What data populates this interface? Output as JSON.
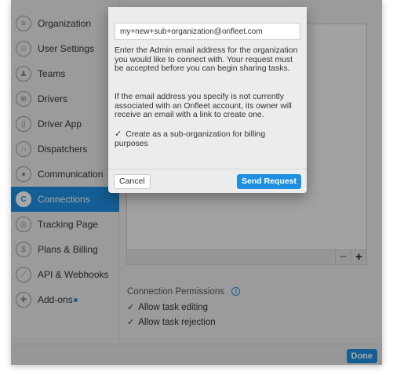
{
  "sidebar": {
    "items": [
      {
        "label": "Organization",
        "icon": "building-icon",
        "glyph": "≡",
        "active": false
      },
      {
        "label": "User Settings",
        "icon": "user-icon",
        "glyph": "☺",
        "active": false
      },
      {
        "label": "Teams",
        "icon": "team-icon",
        "glyph": "♟",
        "active": false
      },
      {
        "label": "Drivers",
        "icon": "steering-wheel-icon",
        "glyph": "⊗",
        "active": false
      },
      {
        "label": "Driver App",
        "icon": "phone-icon",
        "glyph": "▯",
        "active": false
      },
      {
        "label": "Dispatchers",
        "icon": "headset-icon",
        "glyph": "∩",
        "active": false
      },
      {
        "label": "Communication",
        "icon": "chat-bubble-icon",
        "glyph": "●",
        "active": false
      },
      {
        "label": "Connections",
        "icon": "connections-icon",
        "glyph": "C",
        "active": true
      },
      {
        "label": "Tracking Page",
        "icon": "target-icon",
        "glyph": "◎",
        "active": false
      },
      {
        "label": "Plans & Billing",
        "icon": "dollar-icon",
        "glyph": "$",
        "active": false
      },
      {
        "label": "API & Webhooks",
        "icon": "wrench-icon",
        "glyph": "⟋",
        "active": false
      },
      {
        "label": "Add-ons",
        "icon": "puzzle-icon",
        "glyph": "✚",
        "active": false,
        "has_dot": true
      }
    ]
  },
  "list_toolbar": {
    "remove_label": "−",
    "add_label": "+"
  },
  "permissions": {
    "title": "Connection Permissions",
    "options": [
      {
        "label": "Allow task editing",
        "checked": true
      },
      {
        "label": "Allow task rejection",
        "checked": true
      }
    ]
  },
  "footer": {
    "done_label": "Done"
  },
  "dialog": {
    "email_value": "my+new+sub+organization@onfleet.com",
    "paragraph1": "Enter the Admin email address for the organization you would like to connect with. Your request must be accepted before you can begin sharing tasks.",
    "paragraph2": "If the email address you specify is not currently associated with an Onfleet account, its owner will receive an email with a link to create one.",
    "suborg_checkbox_label": "Create as a sub-organization for billing purposes",
    "suborg_checked": true,
    "cancel_label": "Cancel",
    "send_label": "Send Request"
  },
  "colors": {
    "accent": "#1e8fe1",
    "background": "#ececec"
  }
}
